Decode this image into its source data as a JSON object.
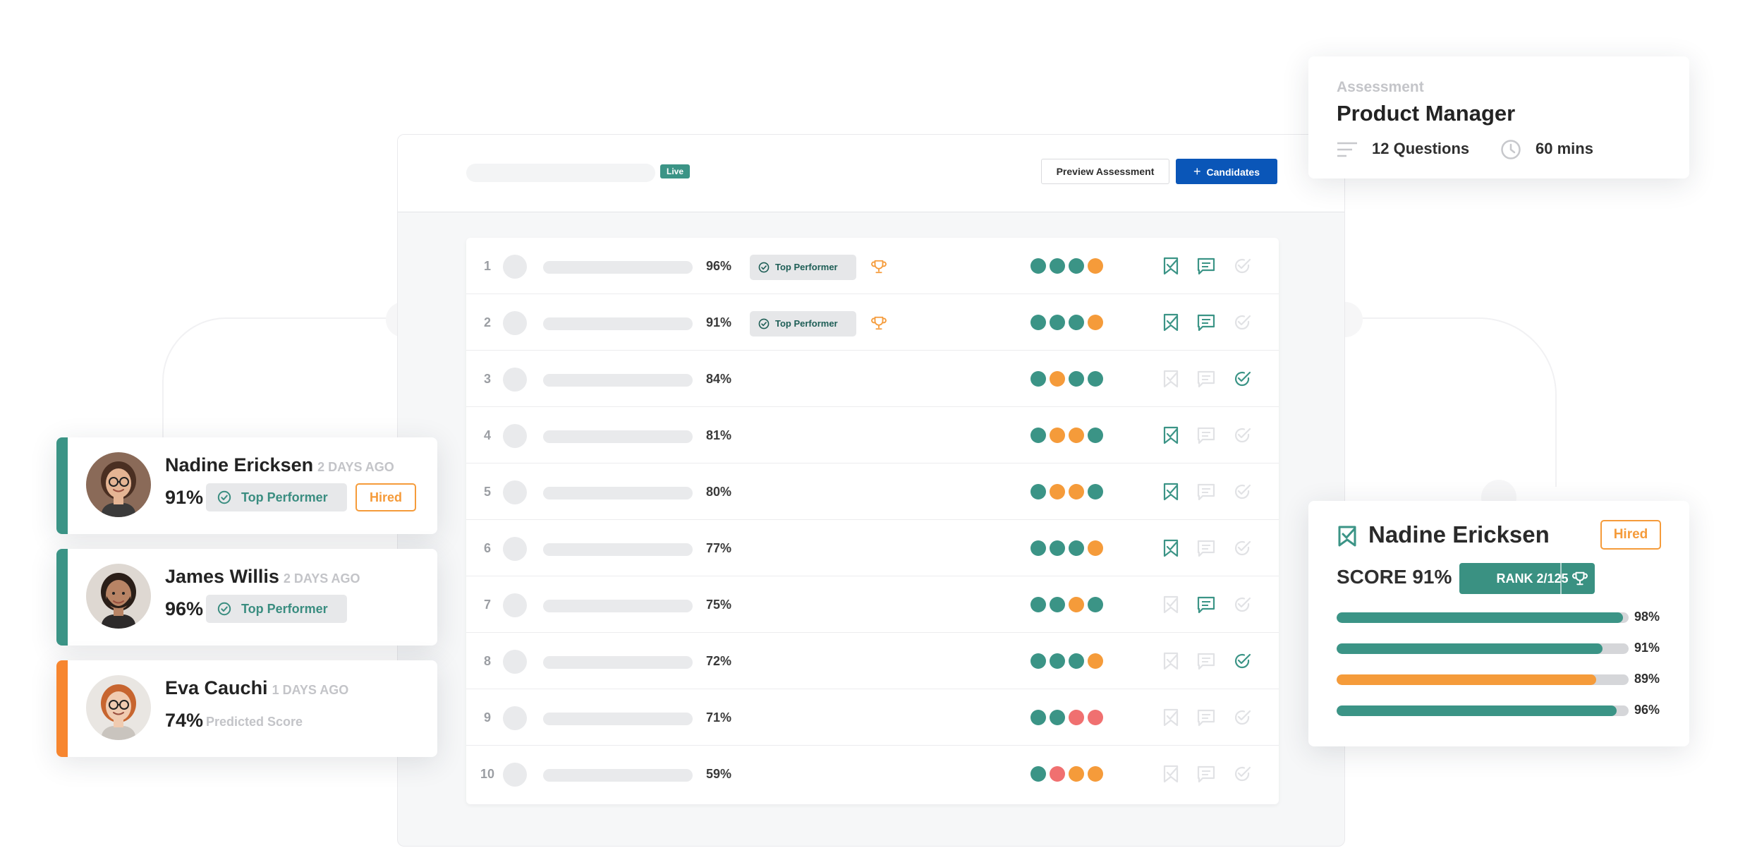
{
  "app": {
    "live_label": "Live",
    "preview_label": "Preview Assessment",
    "candidates_label": "Candidates"
  },
  "colors": {
    "teal": "#3b9486",
    "orange": "#f59b3a",
    "red": "#f07070",
    "blue": "#0a56b8",
    "gray": "#e4e5e8"
  },
  "rows": [
    {
      "rank": "1",
      "pct": "96%",
      "top_performer": true,
      "trophy": true,
      "dots": [
        "teal",
        "teal",
        "teal",
        "orange"
      ],
      "actions": [
        true,
        true,
        false
      ]
    },
    {
      "rank": "2",
      "pct": "91%",
      "top_performer": true,
      "trophy": true,
      "dots": [
        "teal",
        "teal",
        "teal",
        "orange"
      ],
      "actions": [
        true,
        true,
        false
      ]
    },
    {
      "rank": "3",
      "pct": "84%",
      "top_performer": false,
      "trophy": false,
      "dots": [
        "teal",
        "orange",
        "teal",
        "teal"
      ],
      "actions": [
        false,
        false,
        true
      ]
    },
    {
      "rank": "4",
      "pct": "81%",
      "top_performer": false,
      "trophy": false,
      "dots": [
        "teal",
        "orange",
        "orange",
        "teal"
      ],
      "actions": [
        true,
        false,
        false
      ]
    },
    {
      "rank": "5",
      "pct": "80%",
      "top_performer": false,
      "trophy": false,
      "dots": [
        "teal",
        "orange",
        "orange",
        "teal"
      ],
      "actions": [
        true,
        false,
        false
      ]
    },
    {
      "rank": "6",
      "pct": "77%",
      "top_performer": false,
      "trophy": false,
      "dots": [
        "teal",
        "teal",
        "teal",
        "orange"
      ],
      "actions": [
        true,
        false,
        false
      ]
    },
    {
      "rank": "7",
      "pct": "75%",
      "top_performer": false,
      "trophy": false,
      "dots": [
        "teal",
        "teal",
        "orange",
        "teal"
      ],
      "actions": [
        false,
        true,
        false
      ]
    },
    {
      "rank": "8",
      "pct": "72%",
      "top_performer": false,
      "trophy": false,
      "dots": [
        "teal",
        "teal",
        "teal",
        "orange"
      ],
      "actions": [
        false,
        false,
        true
      ]
    },
    {
      "rank": "9",
      "pct": "71%",
      "top_performer": false,
      "trophy": false,
      "dots": [
        "teal",
        "teal",
        "red",
        "red"
      ],
      "actions": [
        false,
        false,
        false
      ]
    },
    {
      "rank": "10",
      "pct": "59%",
      "top_performer": false,
      "trophy": false,
      "dots": [
        "teal",
        "red",
        "orange",
        "orange"
      ],
      "actions": [
        false,
        false,
        false
      ]
    }
  ],
  "top_performer_label": "Top Performer",
  "assessment": {
    "label": "Assessment",
    "title": "Product Manager",
    "questions": "12 Questions",
    "duration": "60 mins"
  },
  "candidates": [
    {
      "name": "Nadine Ericksen",
      "ago": "2 DAYS AGO",
      "score": "91%",
      "tag": "Top Performer",
      "status": "Hired",
      "bar_color": "#3b9486",
      "predicted": ""
    },
    {
      "name": "James Willis",
      "ago": "2 DAYS AGO",
      "score": "96%",
      "tag": "Top Performer",
      "status": "",
      "bar_color": "#3b9486",
      "predicted": ""
    },
    {
      "name": "Eva Cauchi",
      "ago": "1 DAYS AGO",
      "score": "74%",
      "tag": "",
      "status": "",
      "bar_color": "#f7862f",
      "predicted": "Predicted Score"
    }
  ],
  "detail": {
    "name": "Nadine Ericksen",
    "status": "Hired",
    "score": "SCORE 91%",
    "rank": "RANK 2/125",
    "bars": [
      {
        "value": 98,
        "label": "98%",
        "color": "teal"
      },
      {
        "value": 91,
        "label": "91%",
        "color": "teal"
      },
      {
        "value": 89,
        "label": "89%",
        "color": "orange"
      },
      {
        "value": 96,
        "label": "96%",
        "color": "teal"
      }
    ]
  }
}
